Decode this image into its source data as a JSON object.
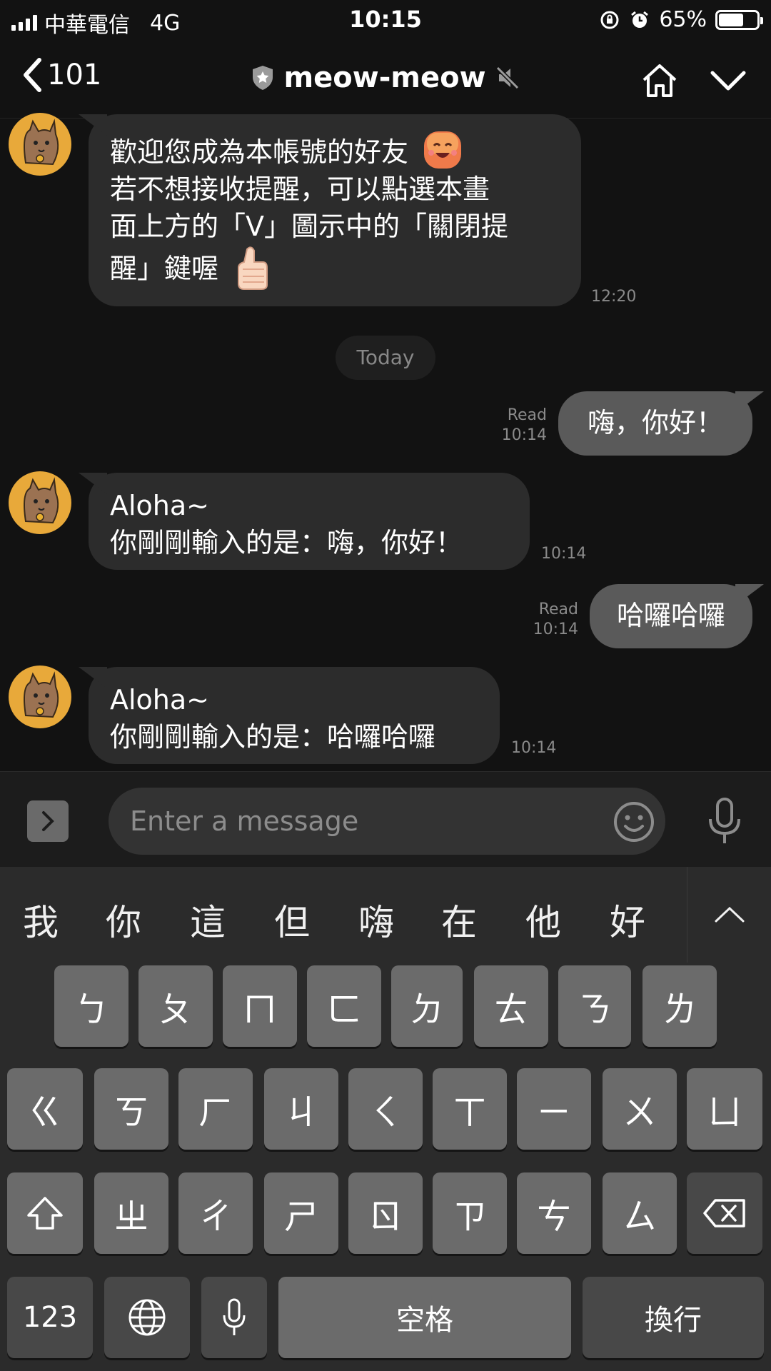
{
  "status_bar": {
    "carrier": "中華電信",
    "network": "4G",
    "time": "10:15",
    "battery": "65%",
    "battery_level": 0.65
  },
  "header": {
    "back_count": "101",
    "title": "meow-meow",
    "icons": [
      "back-chevron-icon",
      "shield-star-icon",
      "muted-speaker-icon",
      "home-icon",
      "chevron-down-icon"
    ]
  },
  "messages": [
    {
      "direction": "in",
      "lines": [
        "歡迎您成為本帳號的好友",
        "若不想接收提醒，可以點選本畫",
        "面上方的「V」圖示中的「關閉提",
        "醒」鍵喔"
      ],
      "time": "12:20"
    },
    {
      "type": "date_divider",
      "label": "Today"
    },
    {
      "direction": "out",
      "text": "嗨，你好！",
      "read": "Read",
      "time": "10:14"
    },
    {
      "direction": "in",
      "lines": [
        "Aloha~",
        "你剛剛輸入的是：嗨，你好！"
      ],
      "time": "10:14"
    },
    {
      "direction": "out",
      "text": "哈囉哈囉",
      "read": "Read",
      "time": "10:14"
    },
    {
      "direction": "in",
      "lines": [
        "Aloha~",
        "你剛剛輸入的是：哈囉哈囉"
      ],
      "time": "10:14"
    }
  ],
  "input_bar": {
    "placeholder": "Enter a message"
  },
  "keyboard": {
    "suggestions": [
      "我",
      "你",
      "這",
      "但",
      "嗨",
      "在",
      "他",
      "好"
    ],
    "row1": [
      "ㄅ",
      "ㄆ",
      "ㄇ",
      "ㄈ",
      "ㄉ",
      "ㄊ",
      "ㄋ",
      "ㄌ"
    ],
    "row2": [
      "ㄍ",
      "ㄎ",
      "ㄏ",
      "ㄐ",
      "ㄑ",
      "ㄒ",
      "ㄧ",
      "ㄨ",
      "ㄩ"
    ],
    "row3": [
      "ㄓ",
      "ㄔ",
      "ㄕ",
      "ㄖ",
      "ㄗ",
      "ㄘ",
      "ㄙ"
    ],
    "numbers_label": "123",
    "space_label": "空格",
    "return_label": "換行"
  },
  "colors": {
    "background": "#121212",
    "incoming_bubble": "#2c2c2c",
    "outgoing_bubble": "#5a5a5a",
    "keyboard_bg": "#2b2b2b",
    "key": "#6b6b6b"
  }
}
